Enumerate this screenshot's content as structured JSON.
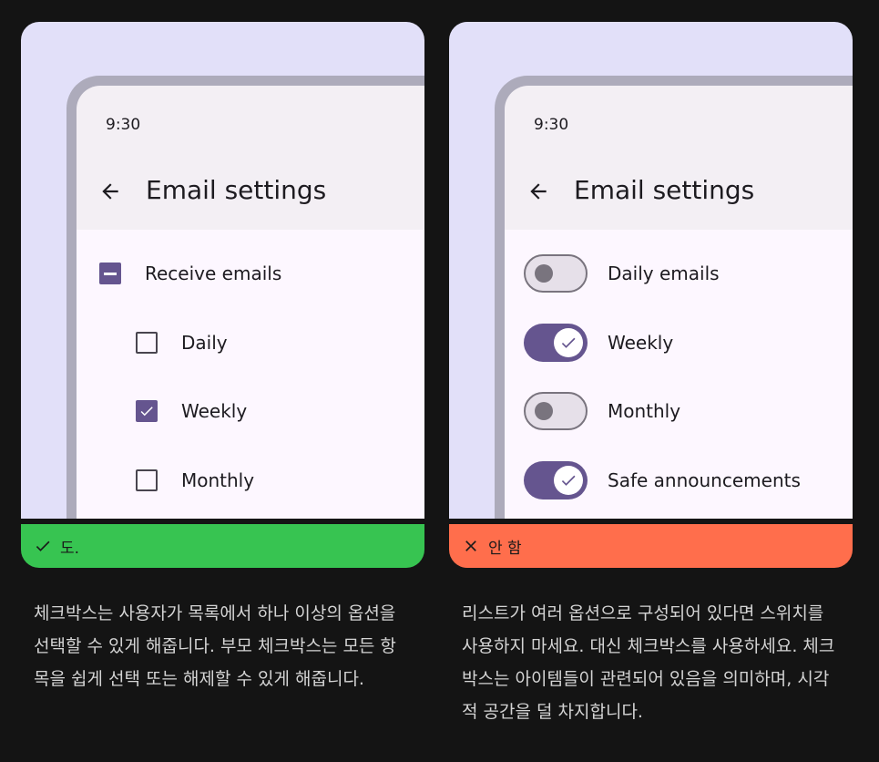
{
  "colors": {
    "page_background": "#141414",
    "stage_background": "#e2e0f9",
    "accent": "#65558f",
    "do_green": "#37c451",
    "dont_orange": "#ff6e4c"
  },
  "left_card": {
    "status_time": "9:30",
    "title": "Email settings",
    "parent_label": "Receive emails",
    "parent_state": "indeterminate",
    "items": [
      {
        "label": "Daily",
        "checked": false
      },
      {
        "label": "Weekly",
        "checked": true
      },
      {
        "label": "Monthly",
        "checked": false
      }
    ],
    "banner_label": "도.",
    "banner_icon": "check-icon"
  },
  "right_card": {
    "status_time": "9:30",
    "title": "Email settings",
    "items": [
      {
        "label": "Daily emails",
        "on": false
      },
      {
        "label": "Weekly",
        "on": true
      },
      {
        "label": "Monthly",
        "on": false
      },
      {
        "label": "Safe announcements",
        "on": true
      }
    ],
    "banner_label": "안 함",
    "banner_icon": "close-icon"
  },
  "descriptions": {
    "left": "체크박스는 사용자가 목록에서 하나 이상의 옵션을 선택할 수 있게 해줍니다. 부모 체크박스는 모든 항목을 쉽게 선택 또는 해제할 수 있게 해줍니다.",
    "right": "리스트가 여러 옵션으로 구성되어 있다면 스위치를 사용하지 마세요. 대신 체크박스를 사용하세요. 체크박스는 아이템들이 관련되어 있음을 의미하며, 시각적 공간을 덜 차지합니다."
  }
}
